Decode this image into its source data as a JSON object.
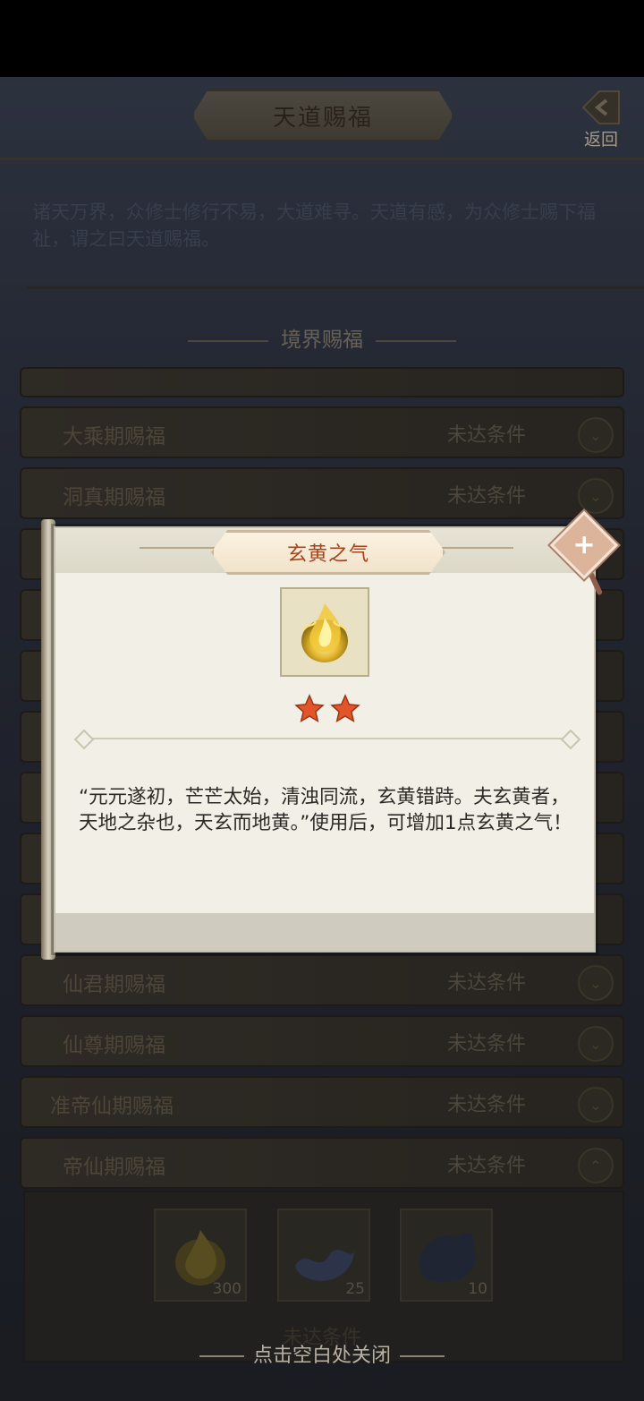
{
  "header": {
    "title": "天道赐福",
    "back_label": "返回"
  },
  "intro": "诸天万界，众修士修行不易，大道难寻。天道有感，为众修士赐下福祉，谓之曰天道赐福。",
  "section_title": "境界赐福",
  "rows": [
    {
      "name": "大乘期赐福",
      "status": "未达条件"
    },
    {
      "name": "洞真期赐福",
      "status": "未达条件"
    },
    {
      "name": "仙君期赐福",
      "status": "未达条件"
    },
    {
      "name": "仙尊期赐福",
      "status": "未达条件"
    },
    {
      "name": "准帝仙期赐福",
      "status": "未达条件"
    },
    {
      "name": "帝仙期赐福",
      "status": "未达条件"
    }
  ],
  "expanded": {
    "rewards": [
      {
        "icon": "golden-flame-icon",
        "count": "300"
      },
      {
        "icon": "blue-wave-icon",
        "count": "25"
      },
      {
        "icon": "dark-orb-icon",
        "count": "10"
      }
    ],
    "status": "未达条件"
  },
  "modal": {
    "title": "玄黄之气",
    "item_icon": "golden-flame-icon",
    "stars": 2,
    "description": "“元元遂初，芒芒太始，清浊同流，玄黄错跱。夫玄黄者，天地之杂也，天玄而地黄。”使用后，可增加1点玄黄之气！"
  },
  "close_hint": "点击空白处关闭",
  "colors": {
    "modal_title": "#a3451c",
    "star": "#e2552a",
    "background": "#2f3442"
  }
}
